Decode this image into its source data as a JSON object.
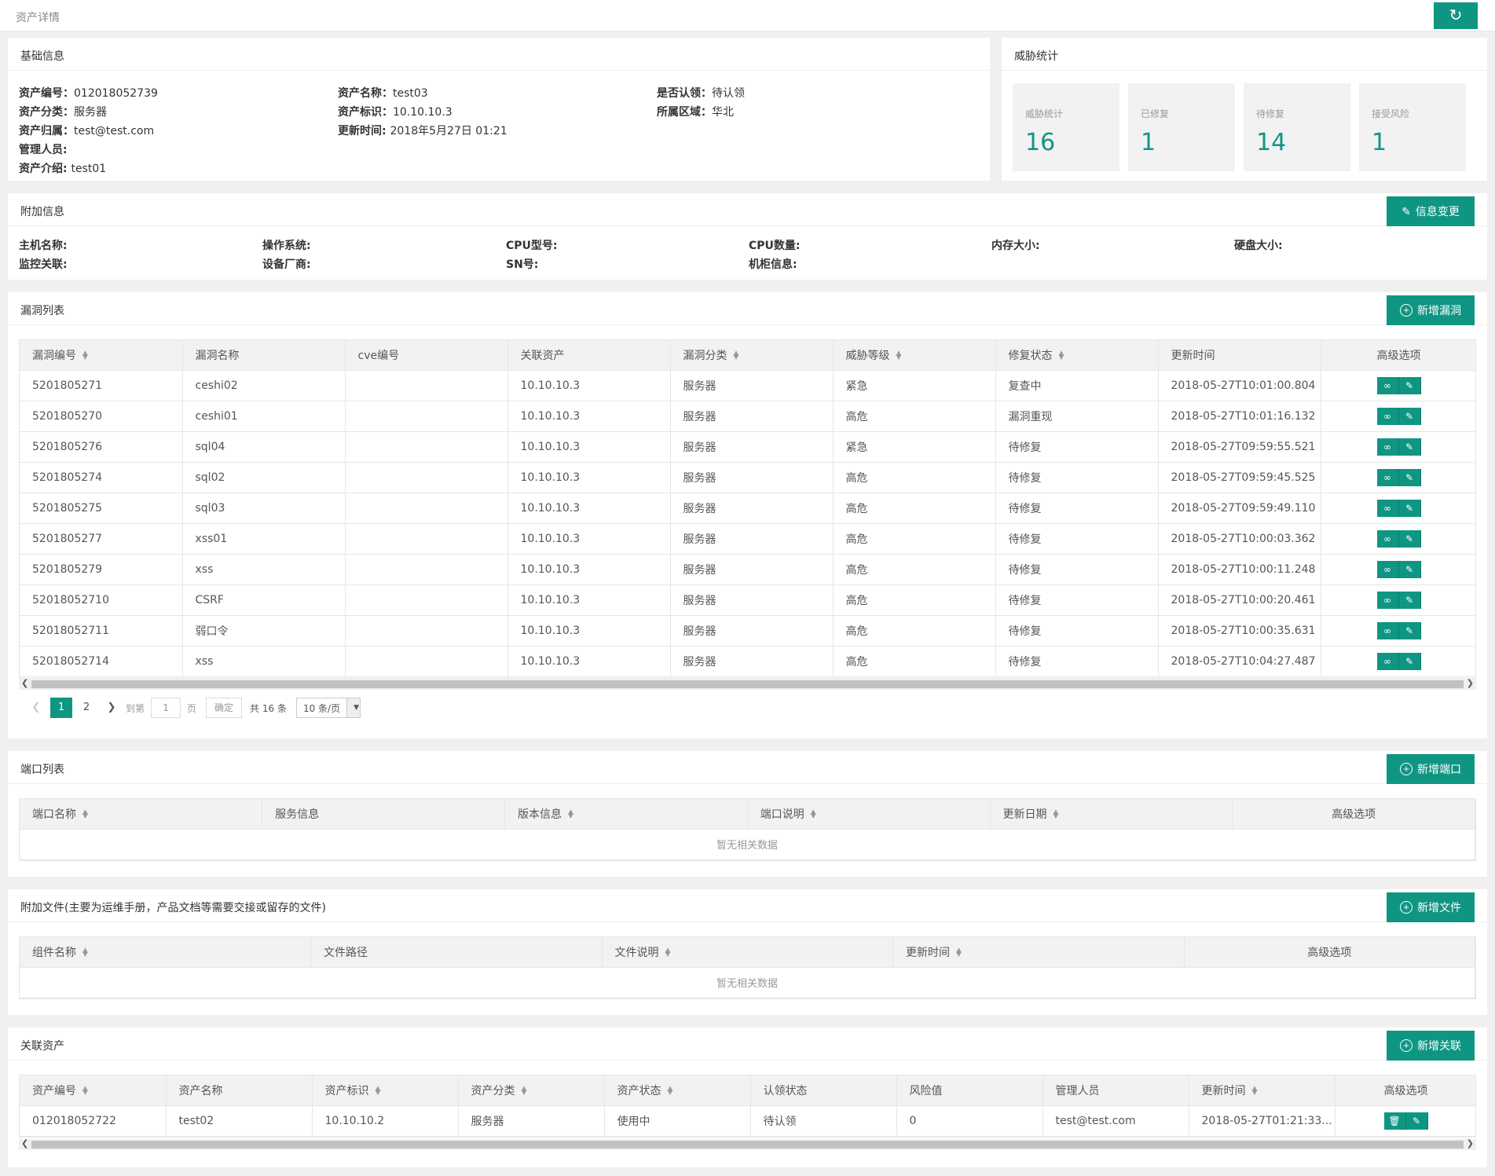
{
  "page": {
    "title": "资产详情"
  },
  "basic": {
    "title": "基础信息",
    "fields": [
      {
        "label": "资产编号：",
        "value": "012018052739"
      },
      {
        "label": "资产名称：",
        "value": "test03"
      },
      {
        "label": "是否认领：",
        "value": "待认领"
      },
      {
        "label": "资产分类：",
        "value": "服务器"
      },
      {
        "label": "资产标识：",
        "value": "10.10.10.3"
      },
      {
        "label": "所属区域：",
        "value": "华北"
      },
      {
        "label": "资产归属：",
        "value": "test@test.com"
      },
      {
        "label": "更新时间: ",
        "value": "2018年5月27日 01:21"
      },
      {
        "label": "管理人员: ",
        "value": ""
      },
      {
        "label": "资产介绍: ",
        "value": "test01"
      }
    ]
  },
  "threat": {
    "title": "威胁统计",
    "boxes": [
      {
        "label": "威胁统计",
        "value": "16"
      },
      {
        "label": "已修复",
        "value": "1"
      },
      {
        "label": "待修复",
        "value": "14"
      },
      {
        "label": "接受风险",
        "value": "1"
      }
    ]
  },
  "extra": {
    "title": "附加信息",
    "button": "信息变更",
    "fields": [
      "主机名称:",
      "操作系统:",
      "CPU型号:",
      "CPU数量:",
      "内存大小:",
      "硬盘大小:",
      "监控关联:",
      "设备厂商:",
      "SN号:",
      "机柜信息:"
    ]
  },
  "vuln": {
    "title": "漏洞列表",
    "button": "新增漏洞",
    "columns": [
      "漏洞编号",
      "漏洞名称",
      "cve编号",
      "关联资产",
      "漏洞分类",
      "威胁等级",
      "修复状态",
      "更新时间",
      "高级选项"
    ],
    "rows": [
      [
        "5201805271",
        "ceshi02",
        "",
        "10.10.10.3",
        "服务器",
        "紧急",
        "复查中",
        "2018-05-27T10:01:00.804"
      ],
      [
        "5201805270",
        "ceshi01",
        "",
        "10.10.10.3",
        "服务器",
        "高危",
        "漏洞重现",
        "2018-05-27T10:01:16.132"
      ],
      [
        "5201805276",
        "sql04",
        "",
        "10.10.10.3",
        "服务器",
        "紧急",
        "待修复",
        "2018-05-27T09:59:55.521"
      ],
      [
        "5201805274",
        "sql02",
        "",
        "10.10.10.3",
        "服务器",
        "高危",
        "待修复",
        "2018-05-27T09:59:45.525"
      ],
      [
        "5201805275",
        "sql03",
        "",
        "10.10.10.3",
        "服务器",
        "高危",
        "待修复",
        "2018-05-27T09:59:49.110"
      ],
      [
        "5201805277",
        "xss01",
        "",
        "10.10.10.3",
        "服务器",
        "高危",
        "待修复",
        "2018-05-27T10:00:03.362"
      ],
      [
        "5201805279",
        "xss",
        "",
        "10.10.10.3",
        "服务器",
        "高危",
        "待修复",
        "2018-05-27T10:00:11.248"
      ],
      [
        "52018052710",
        "CSRF",
        "",
        "10.10.10.3",
        "服务器",
        "高危",
        "待修复",
        "2018-05-27T10:00:20.461"
      ],
      [
        "52018052711",
        "弱口令",
        "",
        "10.10.10.3",
        "服务器",
        "高危",
        "待修复",
        "2018-05-27T10:00:35.631"
      ],
      [
        "52018052714",
        "xss",
        "",
        "10.10.10.3",
        "服务器",
        "高危",
        "待修复",
        "2018-05-27T10:04:27.487"
      ]
    ],
    "pager": {
      "pages": [
        "1",
        "2"
      ],
      "goto": "到第",
      "input": "1",
      "page_unit": "页",
      "ok": "确定",
      "total": "共 16 条",
      "size": "10 条/页"
    }
  },
  "ports": {
    "title": "端口列表",
    "button": "新增端口",
    "columns": [
      "端口名称",
      "服务信息",
      "版本信息",
      "端口说明",
      "更新日期",
      "高级选项"
    ],
    "empty": "暂无相关数据"
  },
  "files": {
    "title": "附加文件(主要为运维手册，产品文档等需要交接或留存的文件)",
    "button": "新增文件",
    "columns": [
      "组件名称",
      "文件路径",
      "文件说明",
      "更新时间",
      "高级选项"
    ],
    "empty": "暂无相关数据"
  },
  "related": {
    "title": "关联资产",
    "button": "新增关联",
    "columns": [
      "资产编号",
      "资产名称",
      "资产标识",
      "资产分类",
      "资产状态",
      "认领状态",
      "风险值",
      "管理人员",
      "更新时间",
      "高级选项"
    ],
    "rows": [
      [
        "012018052722",
        "test02",
        "10.10.10.2",
        "服务器",
        "使用中",
        "待认领",
        "0",
        "test@test.com",
        "2018-05-27T01:21:33..."
      ]
    ]
  },
  "colors": {
    "accent": "#0f9683"
  }
}
